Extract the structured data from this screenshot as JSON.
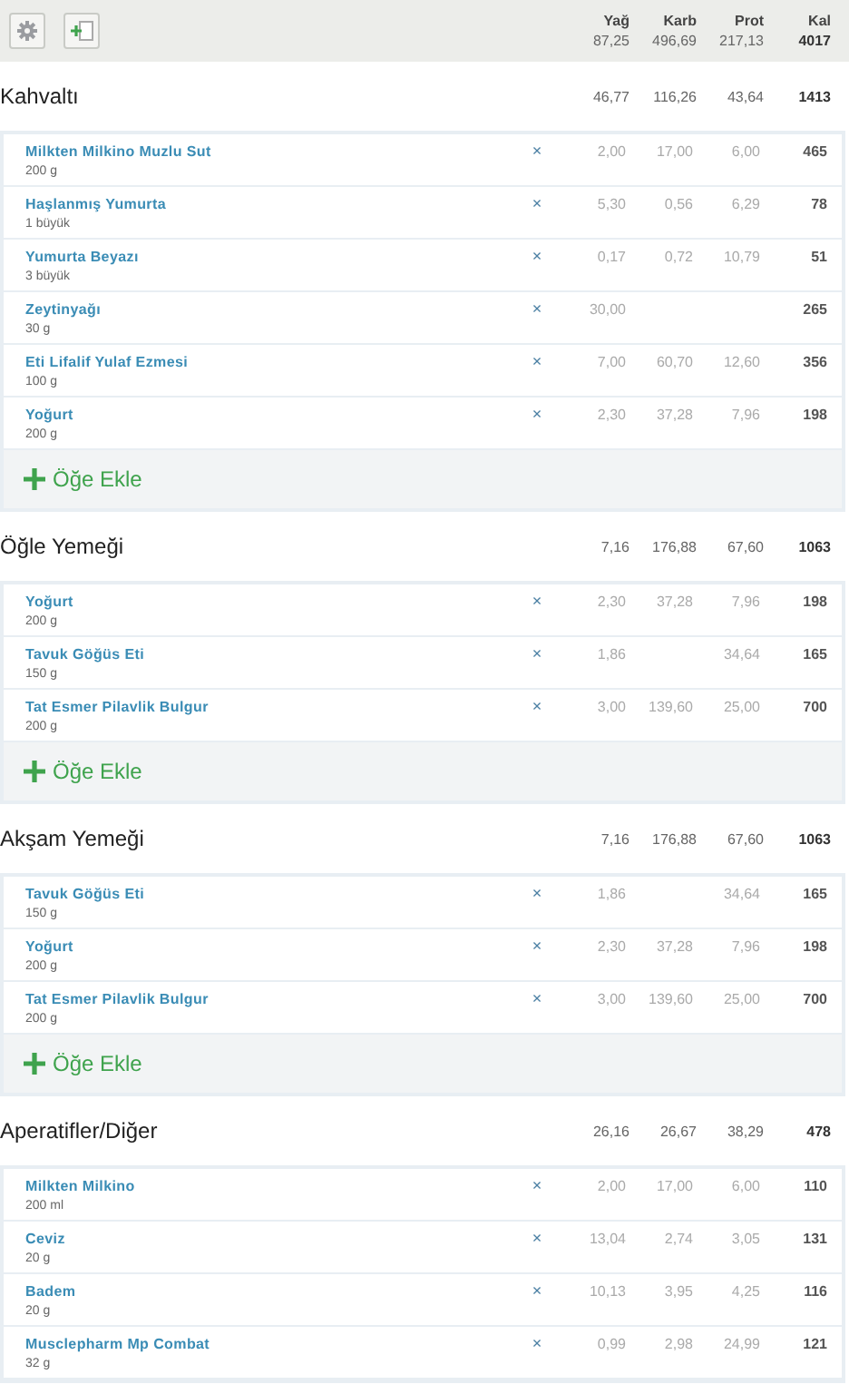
{
  "toolbar": {
    "columns": [
      {
        "label": "Yağ",
        "total": "87,25"
      },
      {
        "label": "Karb",
        "total": "496,69"
      },
      {
        "label": "Prot",
        "total": "217,13"
      },
      {
        "label": "Kal",
        "total": "4017"
      }
    ]
  },
  "meals": [
    {
      "title": "Kahvaltı",
      "totals": [
        "46,77",
        "116,26",
        "43,64",
        "1413"
      ],
      "add_label": "Öğe Ekle",
      "items": [
        {
          "name": "Milkten Milkino Muzlu Sut",
          "amount": "200 g",
          "remove": "×",
          "fat": "2,00",
          "carbs": "17,00",
          "protein": "6,00",
          "kcal": "465"
        },
        {
          "name": "Haşlanmış Yumurta",
          "amount": "1 büyük",
          "remove": "×",
          "fat": "5,30",
          "carbs": "0,56",
          "protein": "6,29",
          "kcal": "78"
        },
        {
          "name": "Yumurta Beyazı",
          "amount": "3 büyük",
          "remove": "×",
          "fat": "0,17",
          "carbs": "0,72",
          "protein": "10,79",
          "kcal": "51"
        },
        {
          "name": "Zeytinyağı",
          "amount": "30 g",
          "remove": "×",
          "fat": "30,00",
          "kcal": "265"
        },
        {
          "name": "Eti Lifalif Yulaf Ezmesi",
          "amount": "100 g",
          "remove": "×",
          "fat": "7,00",
          "carbs": "60,70",
          "protein": "12,60",
          "kcal": "356"
        },
        {
          "name": "Yoğurt",
          "amount": "200 g",
          "remove": "×",
          "fat": "2,30",
          "carbs": "37,28",
          "protein": "7,96",
          "kcal": "198"
        }
      ]
    },
    {
      "title": "Öğle Yemeği",
      "totals": [
        "7,16",
        "176,88",
        "67,60",
        "1063"
      ],
      "add_label": "Öğe Ekle",
      "items": [
        {
          "name": "Yoğurt",
          "amount": "200 g",
          "remove": "×",
          "fat": "2,30",
          "carbs": "37,28",
          "protein": "7,96",
          "kcal": "198"
        },
        {
          "name": "Tavuk Göğüs Eti",
          "amount": "150 g",
          "remove": "×",
          "fat": "1,86",
          "protein": "34,64",
          "kcal": "165"
        },
        {
          "name": "Tat Esmer Pilavlik Bulgur",
          "amount": "200 g",
          "remove": "×",
          "fat": "3,00",
          "carbs": "139,60",
          "protein": "25,00",
          "kcal": "700"
        }
      ]
    },
    {
      "title": "Akşam Yemeği",
      "totals": [
        "7,16",
        "176,88",
        "67,60",
        "1063"
      ],
      "add_label": "Öğe Ekle",
      "items": [
        {
          "name": "Tavuk Göğüs Eti",
          "amount": "150 g",
          "remove": "×",
          "fat": "1,86",
          "protein": "34,64",
          "kcal": "165"
        },
        {
          "name": "Yoğurt",
          "amount": "200 g",
          "remove": "×",
          "fat": "2,30",
          "carbs": "37,28",
          "protein": "7,96",
          "kcal": "198"
        },
        {
          "name": "Tat Esmer Pilavlik Bulgur",
          "amount": "200 g",
          "remove": "×",
          "fat": "3,00",
          "carbs": "139,60",
          "protein": "25,00",
          "kcal": "700"
        }
      ]
    },
    {
      "title": "Aperatifler/Diğer",
      "totals": [
        "26,16",
        "26,67",
        "38,29",
        "478"
      ],
      "items": [
        {
          "name": "Milkten Milkino",
          "amount": "200 ml",
          "remove": "×",
          "fat": "2,00",
          "carbs": "17,00",
          "protein": "6,00",
          "kcal": "110"
        },
        {
          "name": "Ceviz",
          "amount": "20 g",
          "remove": "×",
          "fat": "13,04",
          "carbs": "2,74",
          "protein": "3,05",
          "kcal": "131"
        },
        {
          "name": "Badem",
          "amount": "20 g",
          "remove": "×",
          "fat": "10,13",
          "carbs": "3,95",
          "protein": "4,25",
          "kcal": "116"
        },
        {
          "name": "Musclepharm Mp Combat",
          "amount": "32 g",
          "remove": "×",
          "fat": "0,99",
          "carbs": "2,98",
          "protein": "24,99",
          "kcal": "121"
        }
      ]
    }
  ]
}
